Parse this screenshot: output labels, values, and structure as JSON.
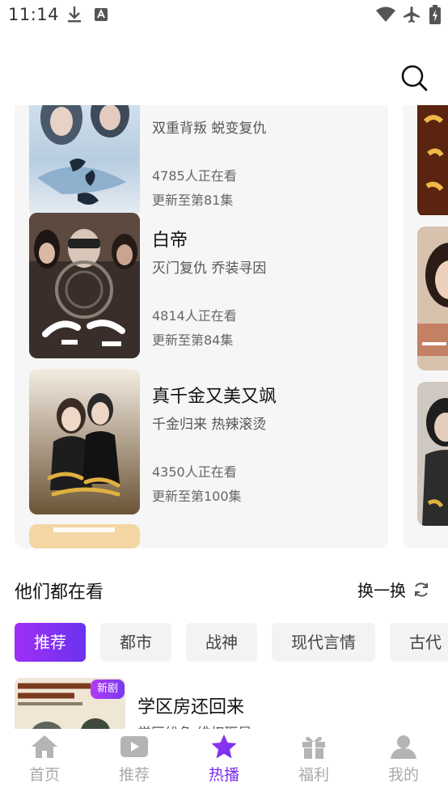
{
  "status_bar": {
    "time": "11:14"
  },
  "search": {
    "icon": "search-icon"
  },
  "dramas": [
    {
      "title": "",
      "desc": "双重背叛 蜕变复仇",
      "viewers": "4785人正在看",
      "episodes": "更新至第81集"
    },
    {
      "title": "白帝",
      "desc": "灭门复仇 乔装寻因",
      "viewers": "4814人正在看",
      "episodes": "更新至第84集"
    },
    {
      "title": "真千金又美又飒",
      "desc": "千金归来 热辣滚烫",
      "viewers": "4350人正在看",
      "episodes": "更新至第100集"
    }
  ],
  "section": {
    "title": "他们都在看",
    "refresh_label": "换一换"
  },
  "tags": [
    "推荐",
    "都市",
    "战神",
    "现代言情",
    "古代"
  ],
  "recommend": {
    "badge": "新剧",
    "title": "学区房还回来",
    "desc": "学区纷争 维权砸局"
  },
  "tab_bar": [
    {
      "label": "首页",
      "icon": "home-icon",
      "active": false
    },
    {
      "label": "推荐",
      "icon": "play-icon",
      "active": false
    },
    {
      "label": "热播",
      "icon": "star-icon",
      "active": true
    },
    {
      "label": "福利",
      "icon": "gift-icon",
      "active": false
    },
    {
      "label": "我的",
      "icon": "user-icon",
      "active": false
    }
  ],
  "colors": {
    "accent": "#7b2ff2",
    "accent_start": "#a02ff5"
  }
}
